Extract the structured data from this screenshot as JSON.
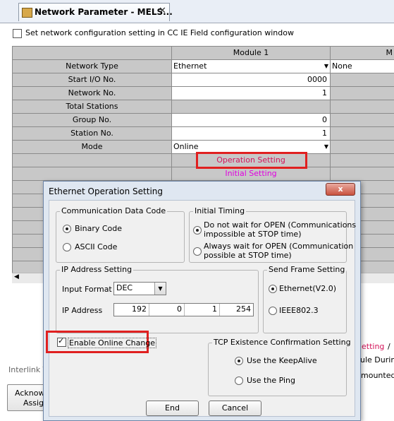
{
  "tab": {
    "title": "Network Parameter - MELS...",
    "close": "✕"
  },
  "config_window_checkbox": {
    "label": "Set network configuration setting in CC IE Field configuration window",
    "checked": false
  },
  "grid": {
    "header_module1": "Module 1",
    "header_module2": "M",
    "rows": [
      {
        "label": "Network Type",
        "m1": "Ethernet",
        "m2": "None"
      },
      {
        "label": "Start I/O No.",
        "m1": "0000",
        "m2": ""
      },
      {
        "label": "Network No.",
        "m1": "1",
        "m2": ""
      },
      {
        "label": "Total Stations",
        "m1": "",
        "m2": ""
      },
      {
        "label": "Group No.",
        "m1": "0",
        "m2": ""
      },
      {
        "label": "Station No.",
        "m1": "1",
        "m2": ""
      },
      {
        "label": "Mode",
        "m1": "Online",
        "m2": ""
      }
    ],
    "operation_setting": "Operation Setting",
    "initial_setting": "Initial Setting"
  },
  "background": {
    "setting_link": "etting",
    "slash": "/",
    "during_text": "ule During",
    "mounted_text": "mounted.",
    "interlink_text": "Interlink T",
    "acknowl_label_1": "Acknowl",
    "acknowl_label_2": "Assig"
  },
  "dialog": {
    "title": "Ethernet Operation Setting",
    "close_label": "x",
    "communication": {
      "title": "Communication Data Code",
      "options": [
        "Binary Code",
        "ASCII Code"
      ],
      "selected": "Binary Code"
    },
    "initial_timing": {
      "title": "Initial Timing",
      "options": [
        {
          "line1": "Do not wait for OPEN (Communications",
          "line2": "impossible at STOP time)"
        },
        {
          "line1": "Always wait for OPEN (Communication",
          "line2": "possible at STOP time)"
        }
      ],
      "selected_index": 0
    },
    "ip_setting": {
      "title": "IP Address Setting",
      "input_format_label": "Input Format",
      "input_format_value": "DEC",
      "ip_label": "IP Address",
      "octets": [
        "192",
        "0",
        "1",
        "254"
      ]
    },
    "send_frame": {
      "title": "Send Frame Setting",
      "options": [
        "Ethernet(V2.0)",
        "IEEE802.3"
      ],
      "selected": "Ethernet(V2.0)"
    },
    "online_change": {
      "label": "Enable Online Change",
      "checked": true
    },
    "tcp": {
      "title": "TCP Existence Confirmation Setting",
      "options": [
        "Use the KeepAlive",
        "Use the Ping"
      ],
      "selected": "Use the KeepAlive"
    },
    "end_button": "End",
    "cancel_button": "Cancel"
  },
  "colors": {
    "highlight": "#e02020",
    "operation_link": "#d4145a",
    "initial_link": "#e000e0"
  }
}
